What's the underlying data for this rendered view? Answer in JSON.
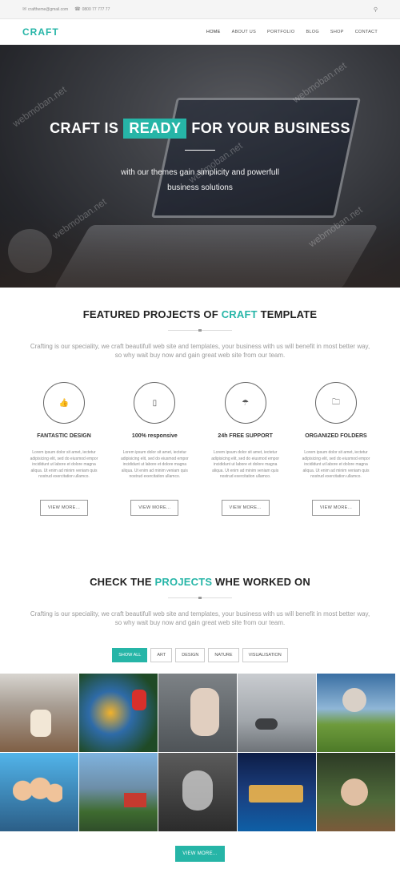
{
  "topbar": {
    "email": "craftheme@gmail.com",
    "phone": "0800 77 777 77",
    "email_icon": "mail-icon",
    "phone_icon": "phone-icon",
    "search_icon": "search-icon"
  },
  "nav": {
    "logo": "CRAFT",
    "items": [
      "HOME",
      "ABOUT US",
      "PORTFOLIO",
      "BLOG",
      "SHOP",
      "CONTACT"
    ]
  },
  "hero": {
    "title_before": "CRAFT IS",
    "title_highlight": "READY",
    "title_after": "FOR YOUR BUSINESS",
    "subtitle_line1": "with our themes gain simplicity and powerfull",
    "subtitle_line2": "business solutions",
    "watermark": "webmoban.net"
  },
  "featured": {
    "title_before": "FEATURED PROJECTS OF",
    "title_accent": "CRAFT",
    "title_after": "TEMPLATE",
    "description": "Crafting is our speciality, we craft beautifull web site and templates, your business with us will benefit in most better way, so why wait buy now and gain great web site from our team.",
    "items": [
      {
        "icon": "thumbs-up-icon",
        "title": "FANTASTIC DESIGN",
        "text": "Lorem ipsum dolor sit amet, iectetur adipisicing elit, sed do eiusmod empor incididunt ut labore et dolore magna aliqua. Ut enim ad minim veniam quis nostrud exercitation ullamco.",
        "button": "VIEW MORE..."
      },
      {
        "icon": "tablet-icon",
        "title": "100% responsive",
        "text": "Lorem ipsum dolor sit amet, iectetur adipisicing elit, sed do eiusmod empor incididunt ut labore et dolore magna aliqua. Ut enim ad minim veniam quis nostrud exercitation ullamco.",
        "button": "VIEW MORE..."
      },
      {
        "icon": "umbrella-icon",
        "title": "24h FREE SUPPORT",
        "text": "Lorem ipsum dolor sit amet, iectetur adipisicing elit, sed do eiusmod empor incididunt ut labore et dolore magna aliqua. Ut enim ad minim veniam quis nostrud exercitation ullamco.",
        "button": "VIEW MORE..."
      },
      {
        "icon": "folder-icon",
        "title": "ORGANIZED FOLDERS",
        "text": "Lorem ipsum dolor sit amet, iectetur adipisicing elit, sed do eiusmod empor incididunt ut labore et dolore magna aliqua. Ut enim ad minim veniam quis nostrud exercitation ullamco.",
        "button": "VIEW MORE..."
      }
    ]
  },
  "projects": {
    "title_before": "CHECK THE",
    "title_accent": "PROJECTS",
    "title_after": "WHE WORKED ON",
    "description": "Crafting is our speciality, we craft beautifull web site and templates, your business with us will benefit in most better way, so why wait buy now and gain great web site from our team.",
    "filters": [
      "SHOW ALL",
      "ART",
      "DESIGN",
      "NATURE",
      "VISUALISATION"
    ],
    "active_filter": "SHOW ALL",
    "view_more": "VIEW MORE..."
  },
  "colors": {
    "accent": "#26b5a7"
  }
}
